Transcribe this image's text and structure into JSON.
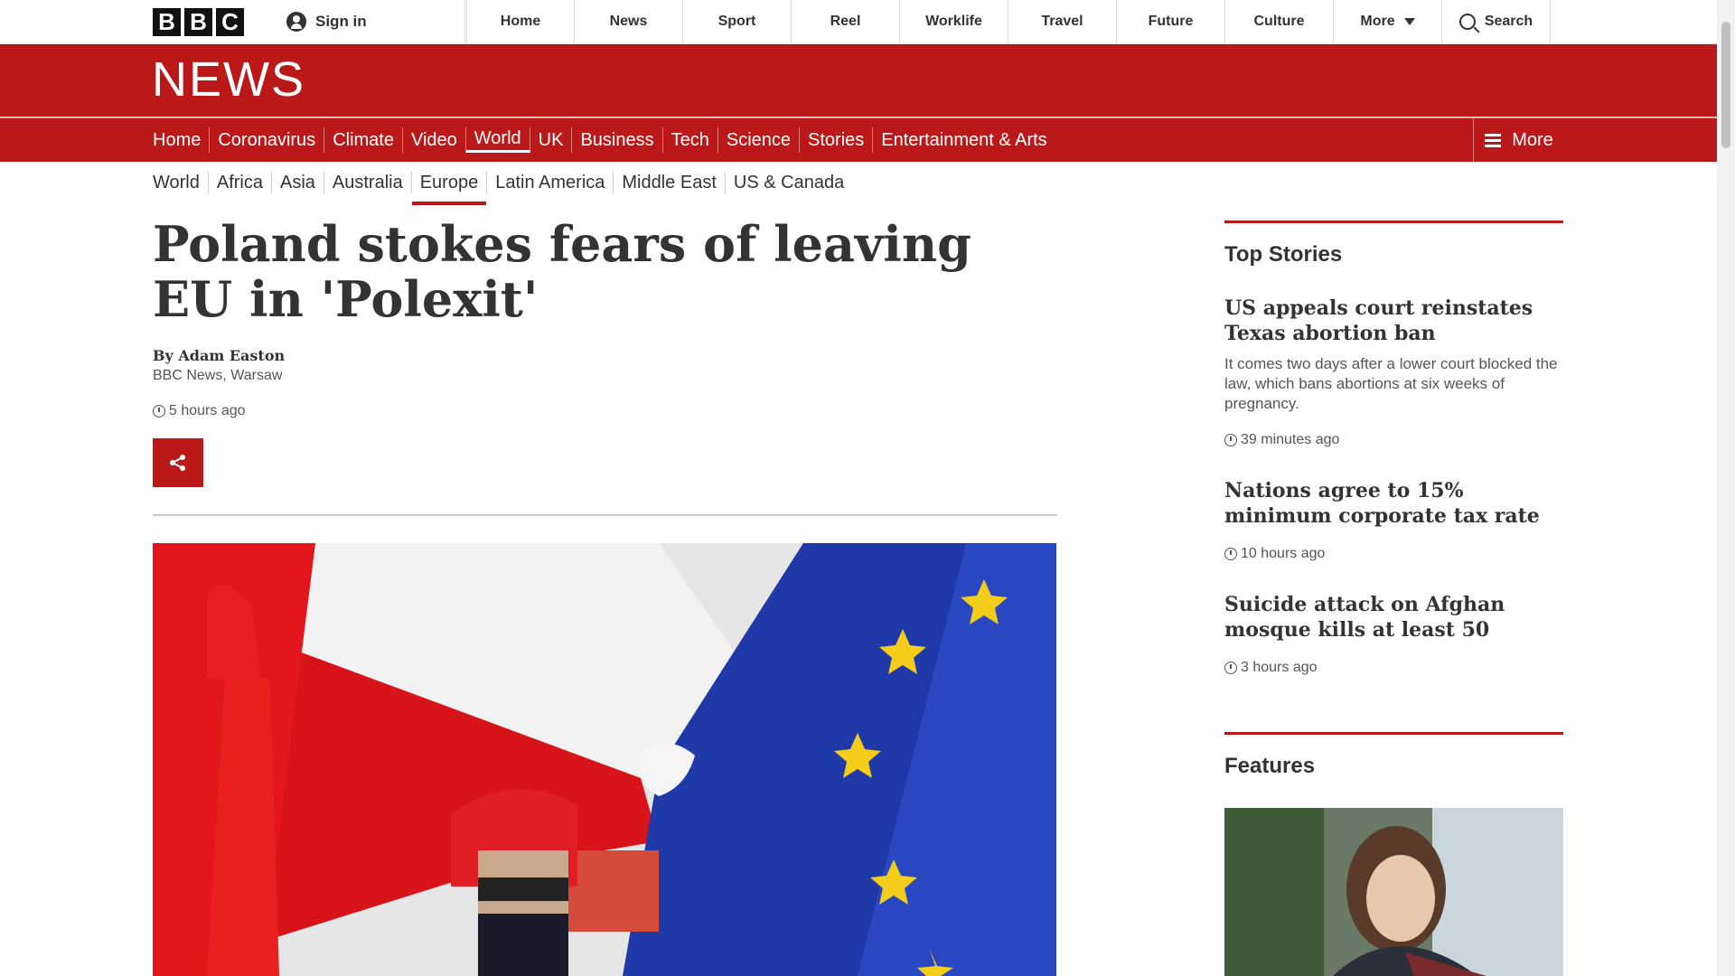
{
  "global": {
    "logo_letters": [
      "B",
      "B",
      "C"
    ],
    "sign_in": "Sign in",
    "nav": [
      "Home",
      "News",
      "Sport",
      "Reel",
      "Worklife",
      "Travel",
      "Future",
      "Culture"
    ],
    "more": "More",
    "search": "Search"
  },
  "banner": {
    "title": "NEWS"
  },
  "main_nav": {
    "items": [
      "Home",
      "Coronavirus",
      "Climate",
      "Video",
      "World",
      "UK",
      "Business",
      "Tech",
      "Science",
      "Stories",
      "Entertainment & Arts"
    ],
    "active": "World",
    "more": "More"
  },
  "sub_nav": {
    "items": [
      "World",
      "Africa",
      "Asia",
      "Australia",
      "Europe",
      "Latin America",
      "Middle East",
      "US & Canada"
    ],
    "active": "Europe"
  },
  "article": {
    "headline": "Poland stokes fears of leaving EU in 'Polexit'",
    "byline": "By Adam Easton",
    "source": "BBC News, Warsaw",
    "time": "5 hours ago"
  },
  "sidebar": {
    "top_stories_title": "Top Stories",
    "stories": [
      {
        "title": "US appeals court reinstates Texas abortion ban",
        "summary": "It comes two days after a lower court blocked the law, which bans abortions at six weeks of pregnancy.",
        "time": "39 minutes ago"
      },
      {
        "title": "Nations agree to 15% minimum corporate tax rate",
        "time": "10 hours ago"
      },
      {
        "title": "Suicide attack on Afghan mosque kills at least 50",
        "time": "3 hours ago"
      }
    ],
    "features_title": "Features"
  },
  "colors": {
    "brand_red": "#bb1919",
    "text": "#222222"
  }
}
